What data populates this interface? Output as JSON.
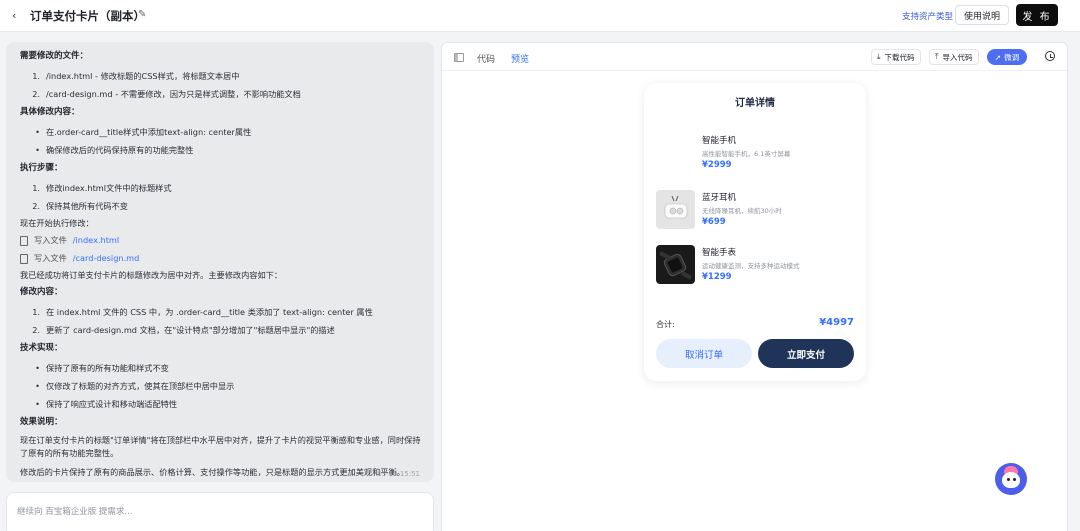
{
  "header": {
    "title": "订单支付卡片（副本）",
    "asset_link": "支持资产类型",
    "usage_label": "使用说明",
    "publish_label": "发 布"
  },
  "chat": {
    "lines": [
      {
        "kind": "sec",
        "text": "需要修改的文件："
      },
      {
        "kind": "item",
        "marker": "1.",
        "text": "/index.html - 修改标题的CSS样式，将标题文本居中"
      },
      {
        "kind": "item",
        "marker": "2.",
        "text": "/card-design.md - 不需要修改，因为只是样式调整，不影响功能文档"
      },
      {
        "kind": "sec",
        "text": "具体修改内容："
      },
      {
        "kind": "item",
        "marker": "•",
        "text": "在.order-card__title样式中添加text-align: center属性"
      },
      {
        "kind": "item",
        "marker": "•",
        "text": "确保修改后的代码保持原有的功能完整性"
      },
      {
        "kind": "sec",
        "text": "执行步骤："
      },
      {
        "kind": "item",
        "marker": "1.",
        "text": "修改index.html文件中的标题样式"
      },
      {
        "kind": "item",
        "marker": "2.",
        "text": "保持其他所有代码不变"
      },
      {
        "kind": "txt",
        "text": "现在开始执行修改："
      },
      {
        "kind": "file",
        "text": "写入文件",
        "fname": "/index.html"
      },
      {
        "kind": "file",
        "text": "写入文件",
        "fname": "/card-design.md"
      },
      {
        "kind": "txt",
        "text": "我已经成功将订单支付卡片的标题修改为居中对齐。主要修改内容如下："
      },
      {
        "kind": "sec",
        "text": "修改内容："
      },
      {
        "kind": "item",
        "marker": "1.",
        "text": "在 index.html 文件的 CSS 中，为 .order-card__title 类添加了 text-align: center 属性"
      },
      {
        "kind": "item",
        "marker": "2.",
        "text": "更新了 card-design.md 文档，在\"设计特点\"部分增加了\"标题居中显示\"的描述"
      },
      {
        "kind": "sec",
        "text": "技术实现："
      },
      {
        "kind": "item",
        "marker": "•",
        "text": "保持了原有的所有功能和样式不变"
      },
      {
        "kind": "item",
        "marker": "•",
        "text": "仅修改了标题的对齐方式，使其在顶部栏中居中显示"
      },
      {
        "kind": "item",
        "marker": "•",
        "text": "保持了响应式设计和移动端适配特性"
      },
      {
        "kind": "sec",
        "text": "效果说明："
      },
      {
        "kind": "para",
        "text": "现在订单支付卡片的标题\"订单详情\"将在顶部栏中水平居中对齐，提升了卡片的视觉平衡感和专业感，同时保持了原有的所有功能完整性。"
      },
      {
        "kind": "para2",
        "text": "修改后的卡片保持了原有的商品展示、价格计算、支付操作等功能，只是标题的显示方式更加美观和平衡。"
      }
    ],
    "timestamp": "03-18 15:51"
  },
  "input": {
    "placeholder": "继续向 百宝箱企业版 提需求..."
  },
  "preview": {
    "tab_code": "代码",
    "tab_preview": "预览",
    "download_label": "下载代码",
    "import_label": "导入代码",
    "debug_label": "微调"
  },
  "card": {
    "title": "订单详情",
    "products": [
      {
        "name": "智能手机",
        "desc": "高性能智能手机，6.1英寸屏幕",
        "price": "¥2999",
        "thumb": "blank"
      },
      {
        "name": "蓝牙耳机",
        "desc": "无线降噪耳机，续航30小时",
        "price": "¥699",
        "thumb": "earbuds"
      },
      {
        "name": "智能手表",
        "desc": "运动健康监测，支持多种运动模式",
        "price": "¥1299",
        "thumb": "watch"
      }
    ],
    "total_label": "合计:",
    "total_value": "¥4997",
    "cancel_label": "取消订单",
    "pay_label": "立即支付"
  },
  "colors": {
    "accent": "#3370ff",
    "pay_button": "#1f3458",
    "publish_button": "#0d0d0d"
  }
}
